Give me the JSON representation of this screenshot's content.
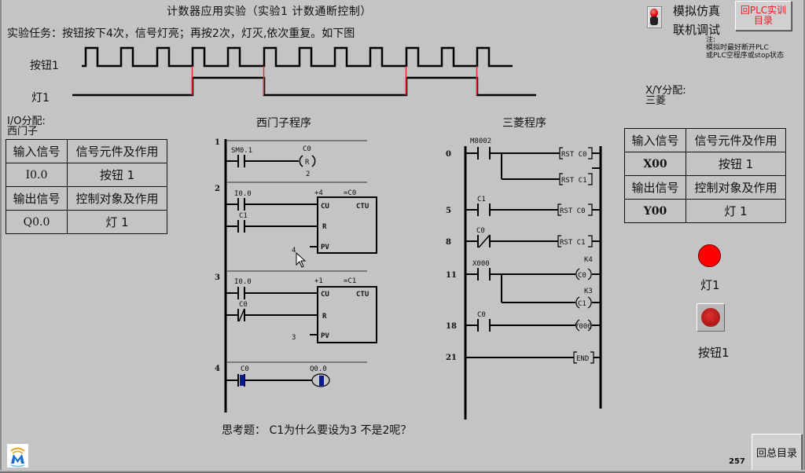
{
  "header": {
    "title": "计数器应用实验（实验1  计数通断控制）",
    "task": "实验任务：按钮按下4次，信号灯亮；再按2次，灯灭,依次重复。如下图"
  },
  "timing": {
    "button_label": "按钮1",
    "lamp_label": "灯1",
    "pulse_count": 12,
    "lamp_on_after_presses": 4,
    "lamp_off_after_presses": 2,
    "lamp_transitions_at_pulse": [
      4,
      6,
      10,
      12
    ],
    "edge_marker_color": "#e03030"
  },
  "mode": {
    "toggle_icon": "red-toggle-switch-icon",
    "simulate": "模拟仿真",
    "online": "联机调试",
    "note_lines": [
      "注:",
      "模拟时最好断开PLC",
      "或PLC空程序或stop状态"
    ]
  },
  "buttons": {
    "plc_menu": [
      "回PLC实训",
      "目录"
    ],
    "home": "回总目录"
  },
  "siemens_io": {
    "heading": "I/O分配:",
    "vendor": "西门子",
    "rows": [
      [
        "输入信号",
        "信号元件及作用"
      ],
      [
        "I0.0",
        "按钮 1"
      ],
      [
        "输出信号",
        "控制对象及作用"
      ],
      [
        "Q0.0",
        "灯 1"
      ]
    ]
  },
  "mitsubishi_io": {
    "heading": "X/Y分配:",
    "vendor": "三菱",
    "rows": [
      [
        "输入信号",
        "信号元件及作用"
      ],
      [
        "X00",
        "按钮 1"
      ],
      [
        "输出信号",
        "控制对象及作用"
      ],
      [
        "Y00",
        "灯 1"
      ]
    ]
  },
  "siemens_program": {
    "title": "西门子程序",
    "rungs": [
      {
        "num": "1",
        "contact": "SM0.1",
        "coil_top": "C0",
        "coil": "R",
        "coil_bottom": "2"
      },
      {
        "num": "2",
        "contact1": "I0.0",
        "contact2": "C1",
        "box_pre": "+4",
        "box_name": "=C0",
        "cu": "CU",
        "ctu": "CTU",
        "r": "R",
        "pv": "PV",
        "pv_value": "4"
      },
      {
        "num": "3",
        "contact1": "I0.0",
        "contact2": "C0",
        "box_pre": "+1",
        "box_name": "=C1",
        "cu": "CU",
        "ctu": "CTU",
        "r": "R",
        "pv": "PV",
        "pv_value": "3"
      },
      {
        "num": "4",
        "contact": "C0",
        "coil": "Q0.0"
      }
    ]
  },
  "mitsubishi_program": {
    "title": "三菱程序",
    "rungs": [
      {
        "step": "0",
        "contact": "M8002",
        "outputs": [
          "RST C0",
          "RST C1"
        ]
      },
      {
        "step": "5",
        "contact": "C1",
        "outputs": [
          "RST C0"
        ]
      },
      {
        "step": "8",
        "contact": "C0",
        "outputs": [
          "RST C1"
        ]
      },
      {
        "step": "11",
        "contact": "X000",
        "outputs": [
          "C0",
          "C1"
        ],
        "consts": [
          "K4",
          "K3"
        ]
      },
      {
        "step": "18",
        "contact": "C0",
        "outputs": [
          "Y000"
        ]
      },
      {
        "step": "21",
        "outputs": [
          "END"
        ]
      }
    ]
  },
  "indicators": {
    "lamp_label": "灯1",
    "lamp_color": "#ff0000",
    "lamp_state": "on",
    "button_label": "按钮1"
  },
  "footer": {
    "question": "思考题： C1为什么要设为3  不是2呢？",
    "page_number": "257"
  }
}
